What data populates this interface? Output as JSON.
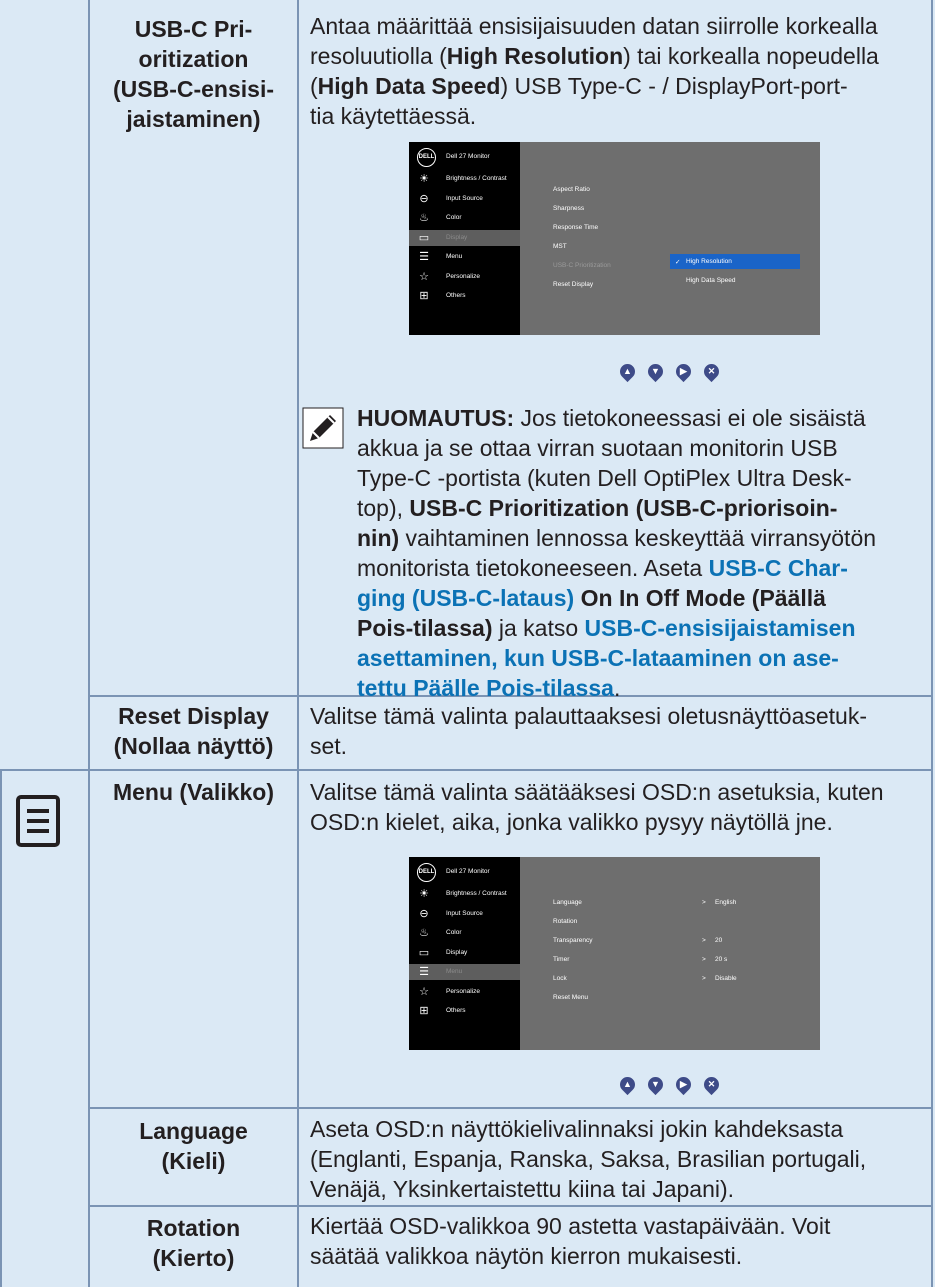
{
  "rows": {
    "usbc": {
      "label": [
        "USB-C Pri-",
        "oritization",
        "(USB-C-ensisi-",
        "jaistaminen)"
      ],
      "desc_lines": [
        [
          {
            "t": "Antaa määrittää ensisijaisuuden datan siirrolle korkealla"
          }
        ],
        [
          {
            "t": "resoluutiolla ("
          },
          {
            "t": "High Resolution",
            "s": "b"
          },
          {
            "t": ") tai korkealla nopeudella"
          }
        ],
        [
          {
            "t": "("
          },
          {
            "t": "High Data Speed",
            "s": "b"
          },
          {
            "t": ") USB Type-C - / DisplayPort-port-"
          }
        ],
        [
          {
            "t": "tia käytettäessä."
          }
        ]
      ]
    },
    "reset": {
      "label": [
        "Reset Display",
        "(Nollaa näyttö)"
      ],
      "desc_lines": [
        [
          {
            "t": "Valitse tämä valinta palauttaaksesi oletusnäyttöasetuk-"
          }
        ],
        [
          {
            "t": "set."
          }
        ]
      ]
    },
    "menu": {
      "label": [
        "Menu (Valikko)"
      ],
      "desc_lines": [
        [
          {
            "t": "Valitse tämä valinta säätääksesi OSD:n asetuksia, kuten"
          }
        ],
        [
          {
            "t": "OSD:n kielet, aika, jonka valikko pysyy näytöllä jne."
          }
        ]
      ]
    },
    "language": {
      "label": [
        "Language",
        "(Kieli)"
      ],
      "desc_lines": [
        [
          {
            "t": "Aseta OSD:n näyttökielivalinnaksi jokin kahdeksasta"
          }
        ],
        [
          {
            "t": "(Englanti, Espanja, Ranska, Saksa, Brasilian portugali,"
          }
        ],
        [
          {
            "t": "Venäjä, Yksinkertaistettu kiina tai Japani)."
          }
        ]
      ]
    },
    "rotation": {
      "label": [
        "Rotation",
        "(Kierto)"
      ],
      "desc_lines": [
        [
          {
            "t": "Kiertää OSD-valikkoa 90 astetta vastapäivään. Voit"
          }
        ],
        [
          {
            "t": "säätää valikkoa näytön kierron mukaisesti."
          }
        ]
      ]
    }
  },
  "note": {
    "lines": [
      [
        {
          "t": "HUOMAUTUS:",
          "s": "b"
        },
        {
          "t": " Jos tietokoneessasi ei ole sisäistä"
        }
      ],
      [
        {
          "t": "akkua ja se ottaa virran suotaan monitorin USB"
        }
      ],
      [
        {
          "t": "Type-C -portista (kuten Dell OptiPlex Ultra Desk-"
        }
      ],
      [
        {
          "t": "top), "
        },
        {
          "t": "USB-C Prioritization (USB-C-priorisoin-",
          "s": "b"
        }
      ],
      [
        {
          "t": "nin)",
          "s": "b"
        },
        {
          "t": " vaihtaminen lennossa keskeyttää virransyötön"
        }
      ],
      [
        {
          "t": "monitorista tietokoneeseen. Aseta "
        },
        {
          "t": "USB-C Char-",
          "s": "blue"
        }
      ],
      [
        {
          "t": "ging (USB-C-lataus)",
          "s": "blue"
        },
        {
          "t": " "
        },
        {
          "t": "On In Off Mode (Päällä",
          "s": "b"
        }
      ],
      [
        {
          "t": "Pois-tilassa)",
          "s": "b"
        },
        {
          "t": " ja katso "
        },
        {
          "t": "USB-C-ensisijaistamisen",
          "s": "blue"
        }
      ],
      [
        {
          "t": "asettaminen, kun USB-C-lataaminen on ase-",
          "s": "blue"
        }
      ],
      [
        {
          "t": "tettu Päälle Pois-tilassa",
          "s": "blue"
        },
        {
          "t": "."
        }
      ]
    ]
  },
  "osd1": {
    "logo": "DELL",
    "title": "Dell 27 Monitor",
    "left_items": [
      "Brightness / Contrast",
      "Input Source",
      "Color",
      "Display",
      "Menu",
      "Personalize",
      "Others"
    ],
    "right_items": [
      "Aspect Ratio",
      "Sharpness",
      "Response Time",
      "MST",
      "USB-C Prioritization",
      "Reset Display"
    ],
    "options": [
      "High Resolution",
      "High Data Speed"
    ]
  },
  "osd2": {
    "logo": "DELL",
    "title": "Dell 27 Monitor",
    "left_items": [
      "Brightness / Contrast",
      "Input Source",
      "Color",
      "Display",
      "Menu",
      "Personalize",
      "Others"
    ],
    "right_items": [
      "Language",
      "Rotation",
      "Transparency",
      "Timer",
      "Lock",
      "Reset Menu"
    ],
    "values": [
      "English",
      "",
      "20",
      "20 s",
      "Disable",
      ""
    ],
    "value_prefix": ">"
  },
  "nav_glyphs": [
    "▲",
    "▼",
    "▶",
    "✕"
  ],
  "icons": [
    "brightness-icon",
    "input-source-icon",
    "color-icon",
    "display-icon",
    "menu-icon",
    "personalize-icon",
    "others-icon"
  ]
}
